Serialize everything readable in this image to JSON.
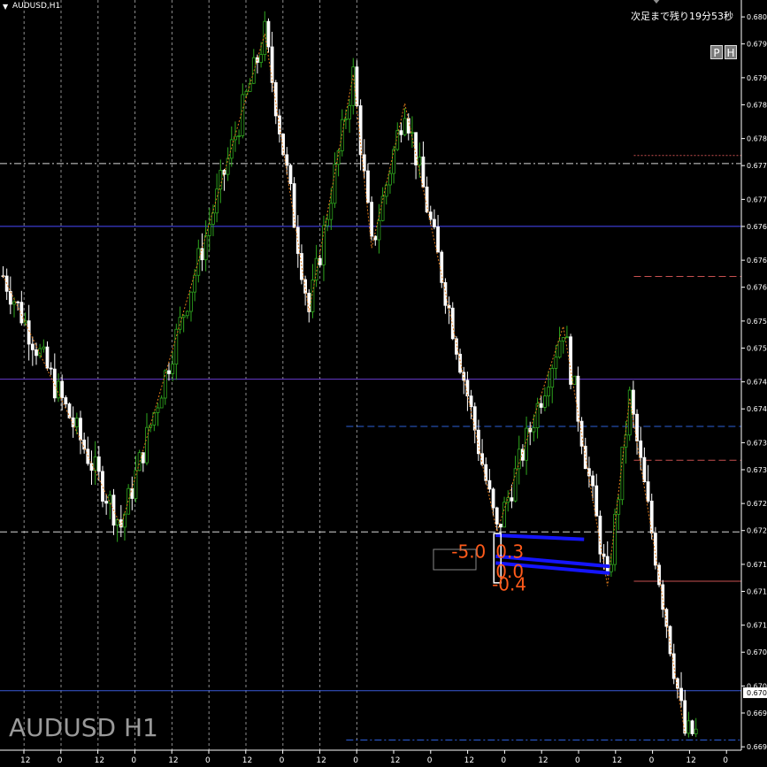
{
  "window": {
    "title": "AUDUSD,H1",
    "countdown": "次足まで残り19分53秒",
    "watermark": "AUDUSD H1",
    "buttons": [
      "P",
      "H"
    ]
  },
  "chart_data": {
    "type": "candlestick",
    "symbol": "AUDUSD",
    "timeframe": "H1",
    "ylim": [
      0.66915,
      0.68025
    ],
    "y_ticks": [
      0.68,
      0.6796,
      0.6791,
      0.6787,
      0.6782,
      0.6778,
      0.6773,
      0.6769,
      0.6764,
      0.676,
      0.6755,
      0.6751,
      0.6746,
      0.6742,
      0.6737,
      0.6733,
      0.6728,
      0.6724,
      0.6719,
      0.6715,
      0.671,
      0.6706,
      0.6701,
      0.6697,
      0.6692
    ],
    "current_price": "0.6700",
    "x_tick_labels": [
      "12",
      "0",
      "12",
      "0",
      "12",
      "0",
      "12",
      "0",
      "12",
      "0",
      "12",
      "0",
      "12",
      "0",
      "12",
      "0",
      "12",
      "0",
      "12",
      "0",
      "12",
      "0",
      "12",
      "0",
      "12",
      "0",
      "12",
      "0"
    ],
    "zigzag": [
      {
        "i": 0,
        "p": 0.67617
      },
      {
        "i": 32,
        "p": 0.67247
      },
      {
        "i": 71,
        "p": 0.67975
      },
      {
        "i": 83,
        "p": 0.67564
      },
      {
        "i": 95,
        "p": 0.67915
      },
      {
        "i": 100,
        "p": 0.67658
      },
      {
        "i": 109,
        "p": 0.67872
      },
      {
        "i": 134,
        "p": 0.67238
      },
      {
        "i": 152,
        "p": 0.67542
      },
      {
        "i": 164,
        "p": 0.67158
      },
      {
        "i": 170,
        "p": 0.67436
      },
      {
        "i": 185,
        "p": 0.6694
      }
    ],
    "horizontal_lines": [
      {
        "price": 0.67783,
        "color": "#d8d8d8",
        "style": "dashdot",
        "from": 0
      },
      {
        "price": 0.6769,
        "color": "#4a4aff",
        "style": "solid",
        "from": 0
      },
      {
        "price": 0.67464,
        "color": "#6a3bd0",
        "style": "solid",
        "from": 0
      },
      {
        "price": 0.67394,
        "color": "#2d5fd8",
        "style": "dashed",
        "from": 0.467
      },
      {
        "price": 0.67238,
        "color": "#d8d8d8",
        "style": "dashed",
        "from": 0
      },
      {
        "price": 0.67003,
        "color": "#3a5ad8",
        "style": "solid",
        "from": 0
      },
      {
        "price": 0.6693,
        "color": "#2d5fd8",
        "style": "dashdot",
        "from": 0.467
      },
      {
        "price": 0.67795,
        "color": "#c85050",
        "style": "dotted",
        "from": 0.855
      },
      {
        "price": 0.67616,
        "color": "#c85050",
        "style": "dashed",
        "from": 0.855
      },
      {
        "price": 0.67344,
        "color": "#c85050",
        "style": "dashed",
        "from": 0.855
      },
      {
        "price": 0.67165,
        "color": "#c85050",
        "style": "solid",
        "from": 0.855
      }
    ],
    "zones": [
      {
        "p1": 0.67233,
        "p2": 0.67227,
        "i1": 134,
        "i2": 158
      },
      {
        "p1": 0.67202,
        "p2": 0.67187,
        "i1": 134,
        "i2": 165
      },
      {
        "p1": 0.67192,
        "p2": 0.67177,
        "i1": 134,
        "i2": 165
      }
    ],
    "annotations": [
      {
        "text": "-5.0",
        "i": 122,
        "p": 0.672
      },
      {
        "text": "0.3",
        "i": 134,
        "p": 0.672
      },
      {
        "text": "0.0",
        "i": 134,
        "p": 0.6717
      },
      {
        "text": "-0.4",
        "i": 133,
        "p": 0.67151
      }
    ]
  }
}
